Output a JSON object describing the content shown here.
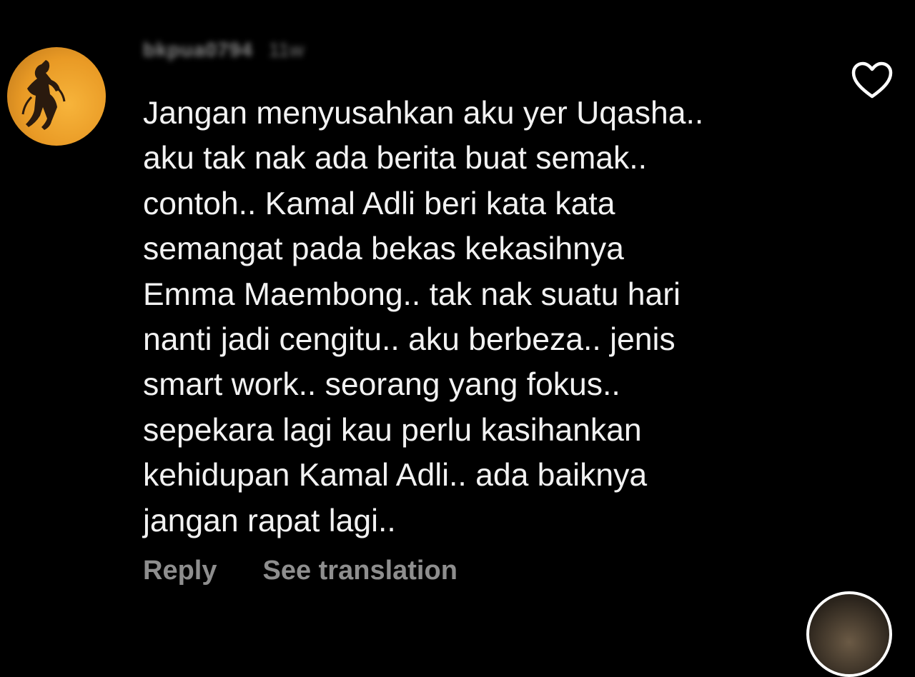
{
  "comment": {
    "username": "bkpua0794",
    "time": "11w",
    "lines": [
      "Jangan menyusahkan aku yer Uqasha..",
      "aku tak nak ada berita buat semak..",
      "contoh.. Kamal Adli beri kata kata",
      "semangat pada bekas kekasihnya",
      "Emma Maembong.. tak nak suatu hari",
      "nanti jadi cengitu.. aku berbeza.. jenis",
      "smart work.. seorang yang fokus..",
      "sepekara lagi kau perlu kasihankan",
      "kehidupan Kamal Adli.. ada baiknya",
      "jangan rapat lagi.."
    ],
    "actions": {
      "reply_label": "Reply",
      "translate_label": "See translation"
    },
    "icons": {
      "like": "heart-icon"
    }
  },
  "colors": {
    "background": "#000000",
    "text": "#f2f2f2",
    "secondary": "#8e8e8e",
    "avatar": "#f0a62f"
  }
}
